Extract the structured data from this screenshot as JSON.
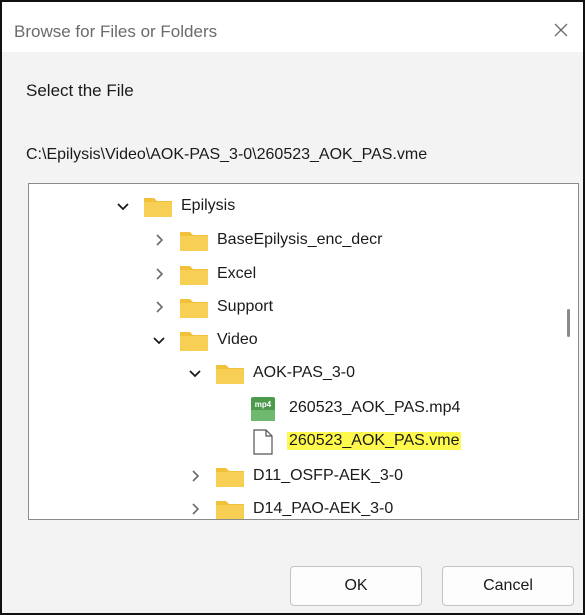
{
  "dialog": {
    "title": "Browse for Files or Folders",
    "prompt": "Select the File",
    "path": "C:\\Epilysis\\Video\\AOK-PAS_3-0\\260523_AOK_PAS.vme",
    "ok_label": "OK",
    "cancel_label": "Cancel"
  },
  "tree": {
    "items": [
      {
        "label": "Epilysis",
        "icon": "folder-icon",
        "state": "expanded"
      },
      {
        "label": "BaseEpilysis_enc_decr",
        "icon": "folder-icon",
        "state": "collapsed"
      },
      {
        "label": "Excel",
        "icon": "folder-icon",
        "state": "collapsed"
      },
      {
        "label": "Support",
        "icon": "folder-icon",
        "state": "collapsed"
      },
      {
        "label": "Video",
        "icon": "folder-icon",
        "state": "expanded"
      },
      {
        "label": "AOK-PAS_3-0",
        "icon": "folder-icon",
        "state": "expanded"
      },
      {
        "label": "260523_AOK_PAS.mp4",
        "icon": "mp4-file-icon",
        "icon_text": "mp4"
      },
      {
        "label": "260523_AOK_PAS.vme",
        "icon": "file-icon",
        "selected": true
      },
      {
        "label": "D11_OSFP-AEK_3-0",
        "icon": "folder-icon",
        "state": "collapsed"
      },
      {
        "label": "D14_PAO-AEK_3-0",
        "icon": "folder-icon",
        "state": "collapsed"
      }
    ]
  },
  "colors": {
    "folder": "#f2c13a",
    "highlight": "#fff94d",
    "mp4_icon": "#4c9a4c"
  }
}
